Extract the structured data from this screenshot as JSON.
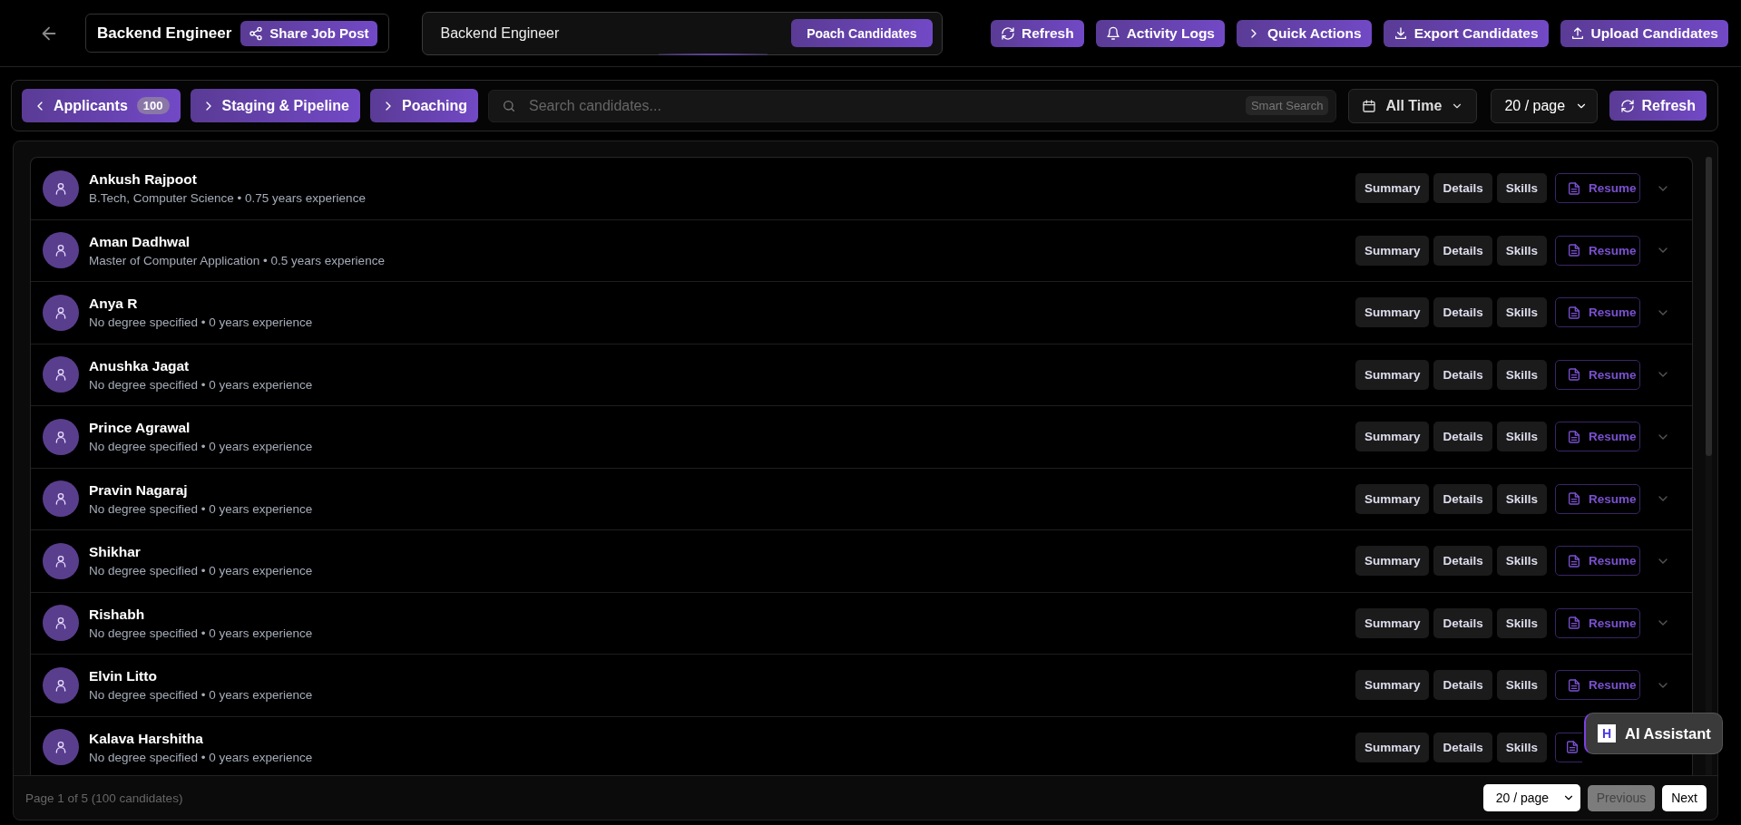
{
  "header": {
    "job_title": "Backend Engineer",
    "share_button": "Share Job Post",
    "search_value": "Backend Engineer",
    "poach_button": "Poach Candidates",
    "actions": [
      "Refresh",
      "Activity Logs",
      "Quick Actions",
      "Export Candidates",
      "Upload Candidates"
    ]
  },
  "filters": {
    "tabs": [
      {
        "label": "Applicants",
        "count": "100"
      },
      {
        "label": "Staging & Pipeline"
      },
      {
        "label": "Poaching"
      }
    ],
    "search_placeholder": "Search candidates...",
    "smart_search": "Smart Search",
    "date_range": "All Time",
    "page_size": "20 / page",
    "refresh": "Refresh"
  },
  "candidates": [
    {
      "name": "Ankush Rajpoot",
      "details": "B.Tech, Computer Science • 0.75 years experience",
      "buttons": [
        "Summary",
        "Details",
        "Skills"
      ],
      "resume": "Resume"
    },
    {
      "name": "Aman Dadhwal",
      "details": "Master of Computer Application • 0.5 years experience",
      "buttons": [
        "Summary",
        "Details",
        "Skills"
      ],
      "resume": "Resume"
    },
    {
      "name": "Anya R",
      "details": "No degree specified • 0 years experience",
      "buttons": [
        "Summary",
        "Details",
        "Skills"
      ],
      "resume": "Resume"
    },
    {
      "name": "Anushka Jagat",
      "details": "No degree specified • 0 years experience",
      "buttons": [
        "Summary",
        "Details",
        "Skills"
      ],
      "resume": "Resume"
    },
    {
      "name": "Prince Agrawal",
      "details": "No degree specified • 0 years experience",
      "buttons": [
        "Summary",
        "Details",
        "Skills"
      ],
      "resume": "Resume"
    },
    {
      "name": "Pravin Nagaraj",
      "details": "No degree specified • 0 years experience",
      "buttons": [
        "Summary",
        "Details",
        "Skills"
      ],
      "resume": "Resume"
    },
    {
      "name": "Shikhar",
      "details": "No degree specified • 0 years experience",
      "buttons": [
        "Summary",
        "Details",
        "Skills"
      ],
      "resume": "Resume"
    },
    {
      "name": "Rishabh",
      "details": "No degree specified • 0 years experience",
      "buttons": [
        "Summary",
        "Details",
        "Skills"
      ],
      "resume": "Resume"
    },
    {
      "name": "Elvin Litto",
      "details": "No degree specified • 0 years experience",
      "buttons": [
        "Summary",
        "Details",
        "Skills"
      ],
      "resume": "Resume"
    },
    {
      "name": "Kalava Harshitha",
      "details": "No degree specified • 0 years experience",
      "buttons": [
        "Summary",
        "Details",
        "Skills"
      ]
    }
  ],
  "footer": {
    "page_info": "Page 1 of 5 (100 candidates)",
    "page_size": "20 / page",
    "previous": "Previous",
    "previous_disabled": true,
    "next": "Next"
  },
  "assistant": {
    "logo": "H",
    "label": "AI Assistant"
  }
}
